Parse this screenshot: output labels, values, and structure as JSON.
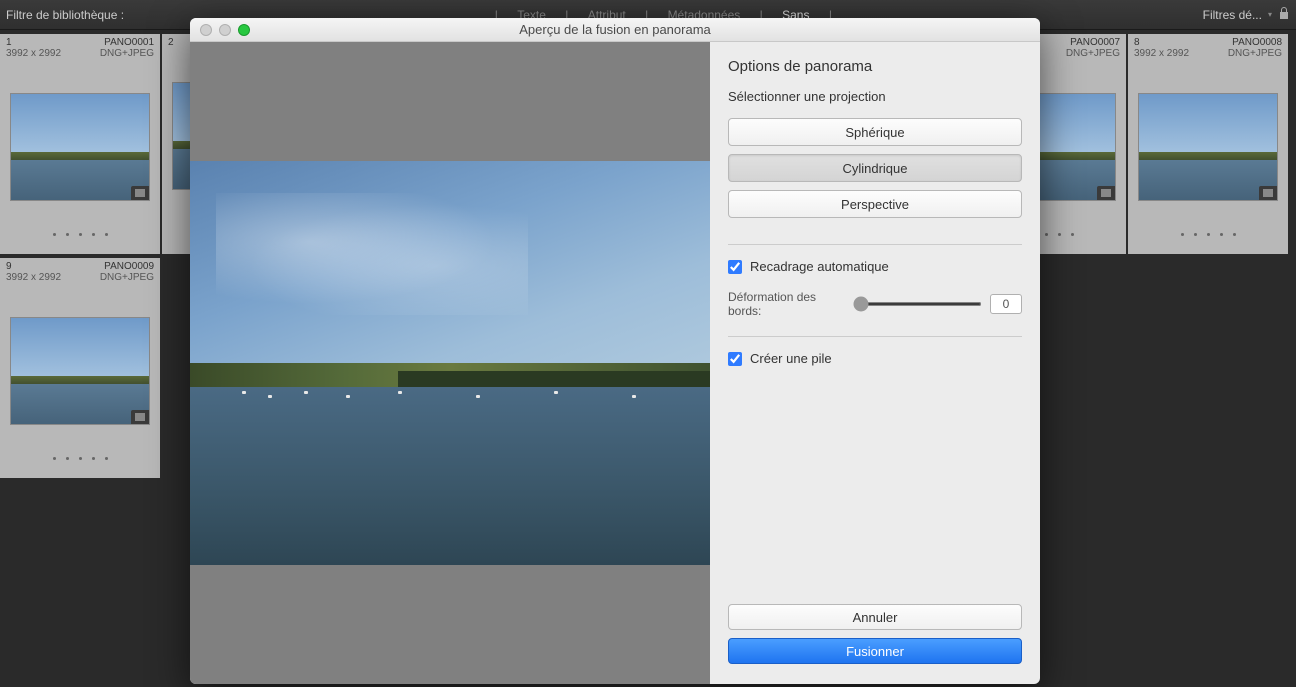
{
  "topbar": {
    "filter_label": "Filtre de bibliothèque :",
    "tabs": [
      "Texte",
      "Attribut",
      "Métadonnées",
      "Sans"
    ],
    "active_tab": 3,
    "filters_dropdown": "Filtres dé..."
  },
  "thumbnails": [
    {
      "index": "1",
      "name": "PANO0001",
      "dims": "3992 x 2992",
      "fmt": "DNG+JPEG"
    },
    {
      "index": "2",
      "name": "",
      "dims": "",
      "fmt": ""
    },
    {
      "index": "",
      "name": "PANO0007",
      "dims": "",
      "fmt": "DNG+JPEG"
    },
    {
      "index": "8",
      "name": "PANO0008",
      "dims": "3992 x 2992",
      "fmt": "DNG+JPEG"
    },
    {
      "index": "9",
      "name": "PANO0009",
      "dims": "3992 x 2992",
      "fmt": "DNG+JPEG"
    }
  ],
  "modal": {
    "title": "Aperçu de la fusion en panorama",
    "options_title": "Options de panorama",
    "projection_label": "Sélectionner une projection",
    "projections": [
      "Sphérique",
      "Cylindrique",
      "Perspective"
    ],
    "selected_projection": 1,
    "autocrop_label": "Recadrage automatique",
    "autocrop_checked": true,
    "boundary_label": "Déformation des bords:",
    "boundary_value": "0",
    "stack_label": "Créer une pile",
    "stack_checked": true,
    "cancel_label": "Annuler",
    "merge_label": "Fusionner"
  }
}
